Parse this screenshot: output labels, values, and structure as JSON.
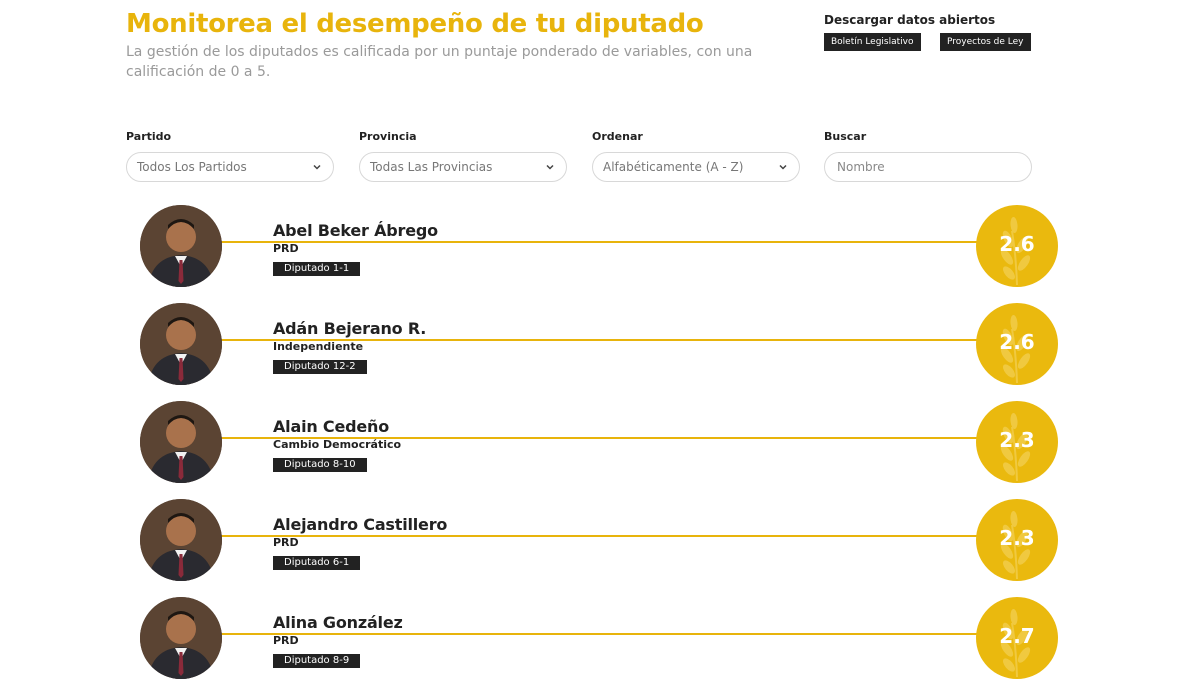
{
  "header": {
    "title": "Monitorea el desempeño de tu diputado",
    "subtitle": "La gestión de los diputados es calificada por un puntaje ponderado de variables, con una calificación de 0 a 5."
  },
  "downloads": {
    "title": "Descargar datos abiertos",
    "buttons": [
      "Boletín Legislativo",
      "Proyectos de Ley"
    ]
  },
  "filters": {
    "party": {
      "label": "Partido",
      "value": "Todos Los Partidos"
    },
    "province": {
      "label": "Provincia",
      "value": "Todas Las Provincias"
    },
    "order": {
      "label": "Ordenar",
      "value": "Alfabéticamente (A - Z)"
    },
    "search": {
      "label": "Buscar",
      "placeholder": "Nombre"
    }
  },
  "deputies": [
    {
      "name": "Abel Beker Ábrego",
      "party": "PRD",
      "district": "Diputado 1-1",
      "score": "2.6"
    },
    {
      "name": "Adán Bejerano R.",
      "party": "Independiente",
      "district": "Diputado 12-2",
      "score": "2.6"
    },
    {
      "name": "Alain Cedeño",
      "party": "Cambio Democrático",
      "district": "Diputado 8-10",
      "score": "2.3"
    },
    {
      "name": "Alejandro Castillero",
      "party": "PRD",
      "district": "Diputado 6-1",
      "score": "2.3"
    },
    {
      "name": "Alina González",
      "party": "PRD",
      "district": "Diputado 8-9",
      "score": "2.7"
    }
  ],
  "colors": {
    "accent": "#e8b40c",
    "dark": "#222222",
    "muted": "#9a9a9a"
  },
  "icons": {
    "chevron": "chevron-down-icon",
    "score_bg": "laurel-icon"
  }
}
